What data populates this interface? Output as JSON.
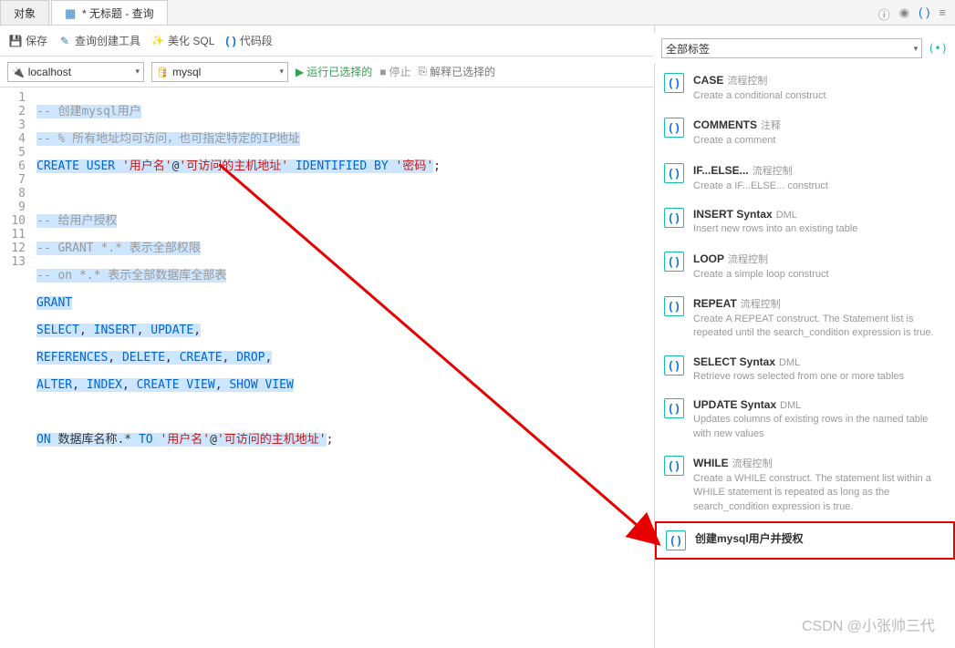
{
  "tabs": {
    "object": "对象",
    "untitled": "* 无标题 - 查询"
  },
  "toolbar": {
    "save": "保存",
    "queryBuilder": "查询创建工具",
    "beautify": "美化 SQL",
    "snippet": "代码段"
  },
  "connRow": {
    "host": "localhost",
    "db": "mysql",
    "run": "运行已选择的",
    "stop": "停止",
    "explain": "解释已选择的"
  },
  "code": {
    "l1_cm": "-- 创建mysql用户",
    "l2_cm": "-- % 所有地址均可访问，也可指定特定的IP地址",
    "l3_kw1": "CREATE",
    "l3_kw2": "USER",
    "l3_s1": "'用户名'",
    "l3_at": "@",
    "l3_s2": "'可访问的主机地址'",
    "l3_kw3": "IDENTIFIED",
    "l3_kw4": "BY",
    "l3_s3": "'密码'",
    "l3_semi": ";",
    "l5_cm": "-- 给用户授权",
    "l6_cm": "-- GRANT *.* 表示全部权限",
    "l7_cm": "-- on *.* 表示全部数据库全部表",
    "l8_kw": "GRANT",
    "l9_kw1": "SELECT",
    "l9_c1": ",",
    "l9_kw2": "INSERT",
    "l9_c2": ",",
    "l9_kw3": "UPDATE",
    "l9_c3": ",",
    "l10_kw1": "REFERENCES",
    "l10_c1": ",",
    "l10_kw2": "DELETE",
    "l10_c2": ",",
    "l10_kw3": "CREATE",
    "l10_c3": ",",
    "l10_kw4": "DROP",
    "l10_c4": ",",
    "l11_kw1": "ALTER",
    "l11_c1": ",",
    "l11_kw2": "INDEX",
    "l11_c2": ",",
    "l11_kw3": "CREATE VIEW",
    "l11_c3": ",",
    "l11_kw4": "SHOW VIEW",
    "l13_kw1": "ON",
    "l13_txt": "数据库名称.*",
    "l13_kw2": "TO",
    "l13_s1": "'用户名'",
    "l13_at": "@",
    "l13_s2": "'可访问的主机地址'",
    "l13_semi": ";"
  },
  "rightPanel": {
    "filter": "全部标签",
    "items": [
      {
        "title": "CASE",
        "cat": "流程控制",
        "desc": "Create a conditional construct"
      },
      {
        "title": "COMMENTS",
        "cat": "注释",
        "desc": "Create a comment"
      },
      {
        "title": "IF...ELSE...",
        "cat": "流程控制",
        "desc": "Create a IF...ELSE... construct"
      },
      {
        "title": "INSERT Syntax",
        "cat": "DML",
        "desc": "Insert new rows into an existing table"
      },
      {
        "title": "LOOP",
        "cat": "流程控制",
        "desc": "Create a simple loop construct"
      },
      {
        "title": "REPEAT",
        "cat": "流程控制",
        "desc": "Create A REPEAT construct. The Statement list is repeated until the search_condition expression is true."
      },
      {
        "title": "SELECT Syntax",
        "cat": "DML",
        "desc": "Retrieve rows selected from one or more tables"
      },
      {
        "title": "UPDATE Syntax",
        "cat": "DML",
        "desc": "Updates columns of existing rows in the named table with new values"
      },
      {
        "title": "WHILE",
        "cat": "流程控制",
        "desc": "Create a WHILE construct. The statement list within a WHILE statement is repeated as long as the search_condition expression is true."
      },
      {
        "title": "创建mysql用户并授权",
        "cat": "",
        "desc": ""
      }
    ]
  },
  "watermark": "CSDN @小张帅三代"
}
